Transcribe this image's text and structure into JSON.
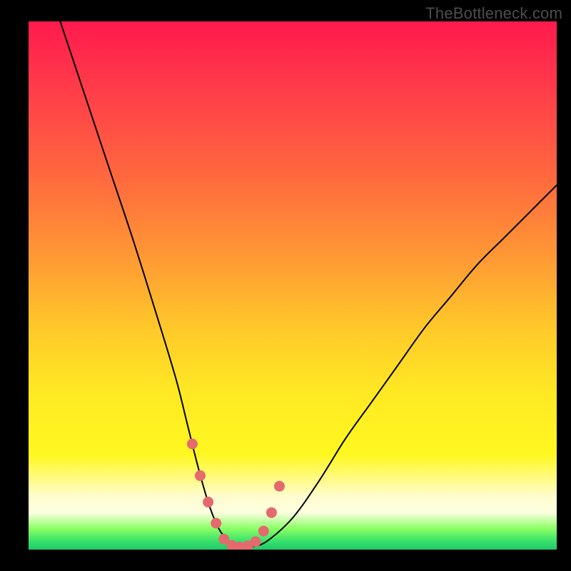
{
  "watermark": "TheBottleneck.com",
  "chart_data": {
    "type": "line",
    "title": "",
    "xlabel": "",
    "ylabel": "",
    "xlim": [
      0,
      100
    ],
    "ylim": [
      0,
      100
    ],
    "grid": false,
    "legend": false,
    "series": [
      {
        "name": "bottleneck-curve",
        "x": [
          6,
          10,
          15,
          20,
          25,
          28,
          30,
          32,
          34,
          36,
          38,
          40,
          42,
          45,
          50,
          55,
          60,
          65,
          70,
          75,
          80,
          85,
          90,
          95,
          100
        ],
        "values": [
          100,
          88,
          73,
          58,
          42,
          32,
          24,
          16,
          9,
          4,
          1.5,
          0.5,
          0.5,
          1.5,
          6,
          13,
          21,
          28,
          35,
          42,
          48,
          54,
          59,
          64,
          69
        ]
      }
    ],
    "markers": {
      "name": "trough-markers",
      "x": [
        31,
        32.5,
        34,
        35.5,
        37,
        38.5,
        40,
        41.5,
        43,
        44.5,
        46,
        47.5
      ],
      "values": [
        20,
        14,
        9,
        5,
        2,
        0.8,
        0.5,
        0.7,
        1.5,
        3.5,
        7,
        12
      ]
    },
    "background": {
      "type": "vertical-gradient",
      "stops": [
        {
          "pos": 0.0,
          "color": "#ff1a4d"
        },
        {
          "pos": 0.3,
          "color": "#ff6a3e"
        },
        {
          "pos": 0.58,
          "color": "#ffc82a"
        },
        {
          "pos": 0.82,
          "color": "#fff820"
        },
        {
          "pos": 0.92,
          "color": "#fffccf"
        },
        {
          "pos": 0.97,
          "color": "#8cff66"
        },
        {
          "pos": 1.0,
          "color": "#22c86a"
        }
      ]
    }
  }
}
